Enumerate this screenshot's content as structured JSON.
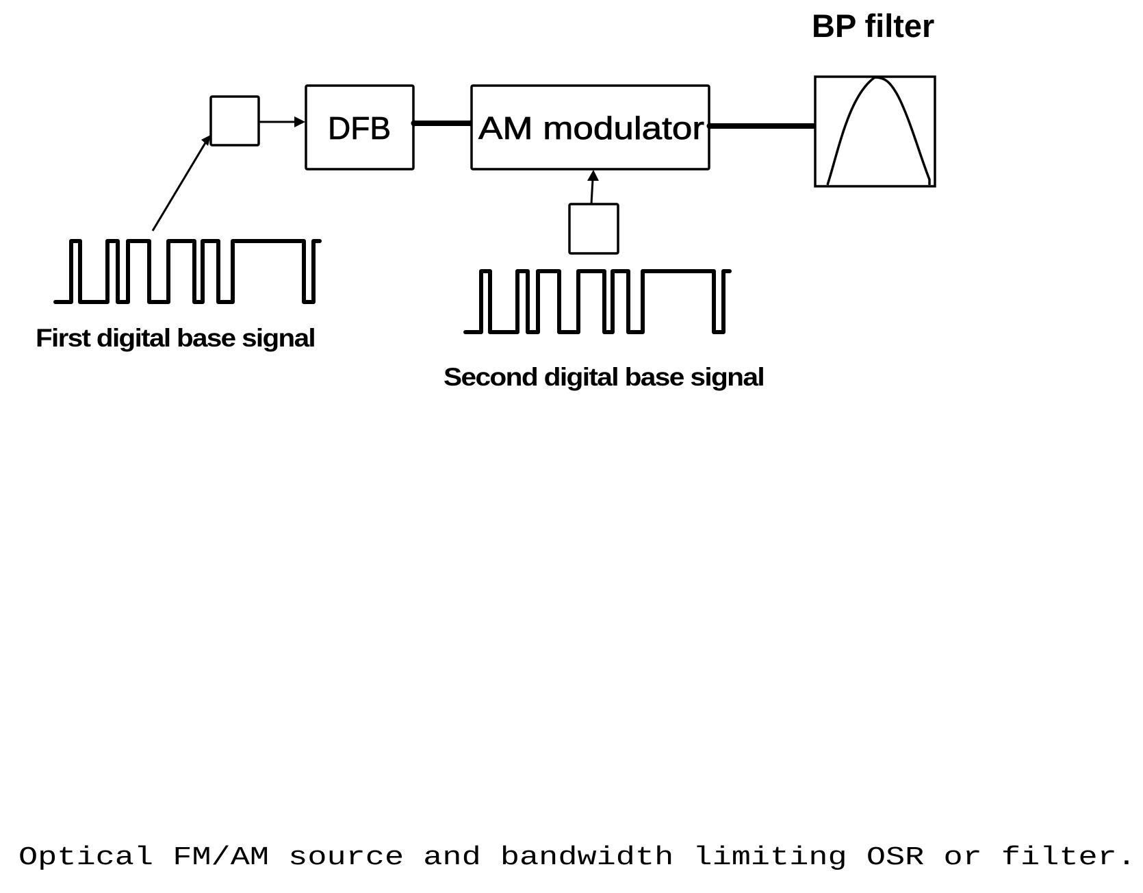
{
  "figure": {
    "title": "BP filter",
    "blocks": {
      "encoder_1": {
        "label": ""
      },
      "dfb": {
        "label": "DFB"
      },
      "am_modulator": {
        "label": "AM modulator"
      },
      "encoder_2": {
        "label": ""
      },
      "bp_filter": {
        "label": "BP filter"
      }
    },
    "signals": [
      {
        "label": "First digital base signal",
        "bits": [
          0,
          1,
          0,
          1,
          0,
          1,
          0,
          1,
          0,
          1,
          0,
          1,
          0,
          1
        ]
      },
      {
        "label": "Second digital base signal",
        "bits": [
          0,
          1,
          0,
          1,
          0,
          1,
          0,
          1,
          0,
          1,
          0,
          1,
          0,
          1
        ]
      }
    ],
    "caption": "Optical FM/AM source and bandwidth limiting OSR or filter."
  }
}
